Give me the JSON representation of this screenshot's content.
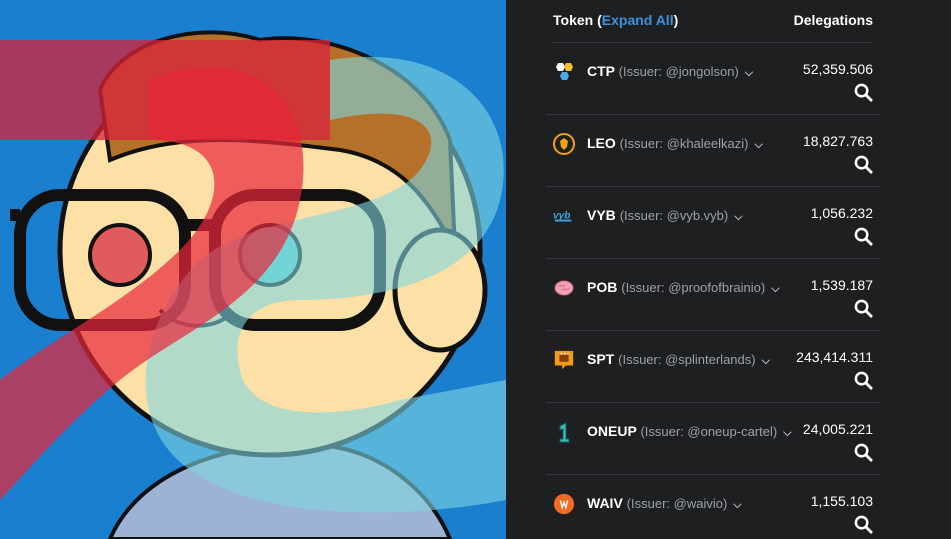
{
  "header": {
    "token_label": "Token",
    "expand_label": "Expand All",
    "delegations_label": "Delegations"
  },
  "tokens": [
    {
      "symbol": "CTP",
      "issuer": "(Issuer: @jongolson)",
      "amount": "52,359.506",
      "icon": "ctp-hexagon-icon",
      "color": "#f2c230"
    },
    {
      "symbol": "LEO",
      "issuer": "(Issuer: @khaleelkazi)",
      "amount": "18,827.763",
      "icon": "leo-lion-icon",
      "color": "#f0a21b"
    },
    {
      "symbol": "VYB",
      "issuer": "(Issuer: @vyb.vyb)",
      "amount": "1,056.232",
      "icon": "vyb-logo-icon",
      "color": "#3aa7e0"
    },
    {
      "symbol": "POB",
      "issuer": "(Issuer: @proofofbrainio)",
      "amount": "1,539.187",
      "icon": "brain-icon",
      "color": "#f3a0b4"
    },
    {
      "symbol": "SPT",
      "issuer": "(Issuer: @splinterlands)",
      "amount": "243,414.311",
      "icon": "splinterlands-icon",
      "color": "#f29a1a"
    },
    {
      "symbol": "ONEUP",
      "issuer": "(Issuer: @oneup-cartel)",
      "amount": "24,005.221",
      "icon": "oneup-icon",
      "color": "#36c4a8"
    },
    {
      "symbol": "WAIV",
      "issuer": "(Issuer: @waivio)",
      "amount": "1,155.103",
      "icon": "waivio-icon",
      "color": "#f26a21"
    }
  ]
}
